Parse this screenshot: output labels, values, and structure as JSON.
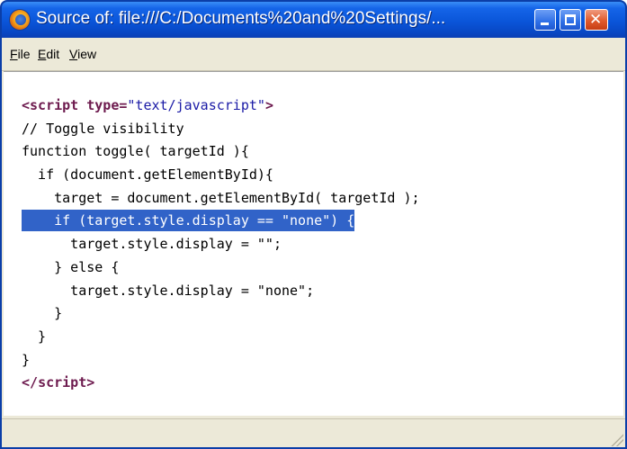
{
  "window": {
    "title": "Source of: file:///C:/Documents%20and%20Settings/...",
    "icon": "firefox-icon"
  },
  "menu": {
    "items": [
      {
        "label": "File",
        "accel": "F"
      },
      {
        "label": "Edit",
        "accel": "E"
      },
      {
        "label": "View",
        "accel": "V"
      }
    ]
  },
  "source": {
    "lines": [
      {
        "parts": [
          {
            "t": "<",
            "c": "tag"
          },
          {
            "t": "script",
            "c": "tag"
          },
          {
            "t": " type=",
            "c": "tag"
          },
          {
            "t": "\"text/javascript\"",
            "c": "str"
          },
          {
            "t": ">",
            "c": "tag"
          }
        ]
      },
      {
        "parts": [
          {
            "t": "// Toggle visibility",
            "c": "plain"
          }
        ]
      },
      {
        "parts": [
          {
            "t": "function toggle( targetId ){",
            "c": "plain"
          }
        ]
      },
      {
        "parts": [
          {
            "t": "  if (document.getElementById){",
            "c": "plain"
          }
        ]
      },
      {
        "parts": [
          {
            "t": "    target = document.getElementById( targetId );",
            "c": "plain"
          }
        ]
      },
      {
        "parts": [
          {
            "t": "    if (target.style.display == \"none\") {",
            "c": "selected"
          }
        ]
      },
      {
        "parts": [
          {
            "t": "      target.style.display = \"\";",
            "c": "plain"
          }
        ]
      },
      {
        "parts": [
          {
            "t": "    } else {",
            "c": "plain"
          }
        ]
      },
      {
        "parts": [
          {
            "t": "      target.style.display = \"none\";",
            "c": "plain"
          }
        ]
      },
      {
        "parts": [
          {
            "t": "    }",
            "c": "plain"
          }
        ]
      },
      {
        "parts": [
          {
            "t": "  }",
            "c": "plain"
          }
        ]
      },
      {
        "parts": [
          {
            "t": "}",
            "c": "plain"
          }
        ]
      },
      {
        "parts": [
          {
            "t": "</",
            "c": "tag"
          },
          {
            "t": "script",
            "c": "tag"
          },
          {
            "t": ">",
            "c": "tag"
          }
        ]
      }
    ],
    "selected_line_index": 5
  },
  "status": {
    "text": ""
  },
  "colors": {
    "selection": "#3163c8",
    "tag": "#6d1a4e",
    "string": "#1a1aa6",
    "titlebar": "#0a55d9"
  }
}
